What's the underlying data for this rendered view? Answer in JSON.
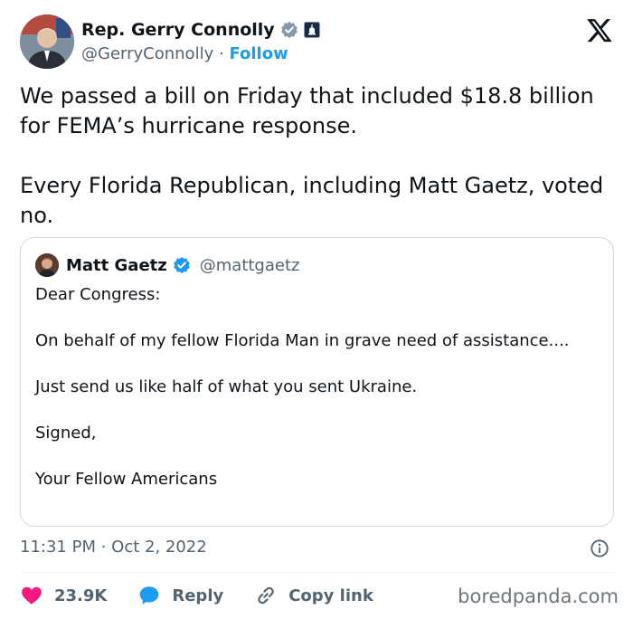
{
  "author": {
    "display_name": "Rep. Gerry Connolly",
    "handle": "@GerryConnolly",
    "separator": "·",
    "follow_label": "Follow"
  },
  "tweet": {
    "paragraph_1": "We passed a bill on Friday that included $18.8 billion for FEMA’s hurricane response.",
    "paragraph_2": "Every Florida Republican, including Matt Gaetz, voted no."
  },
  "quoted_tweet": {
    "display_name": "Matt Gaetz",
    "handle": "@mattgaetz",
    "lines": [
      "Dear Congress:",
      "On behalf of my fellow Florida Man in grave need of assistance....",
      "Just send us like half of what you sent Ukraine.",
      "Signed,",
      "Your Fellow Americans"
    ]
  },
  "meta": {
    "timestamp": "11:31 PM · Oct 2, 2022"
  },
  "actions": {
    "like_count": "23.9K",
    "reply_label": "Reply",
    "copy_link_label": "Copy link"
  },
  "watermark": "boredpanda.com",
  "colors": {
    "accent": "#1d9bf0",
    "like": "#f91880",
    "text_primary": "#0f1419",
    "text_secondary": "#536471",
    "border": "#cfd9de"
  },
  "icons": [
    "verified-badge-icon",
    "government-badge-icon",
    "x-logo-icon",
    "info-icon",
    "heart-icon",
    "reply-bubble-icon",
    "link-icon"
  ]
}
